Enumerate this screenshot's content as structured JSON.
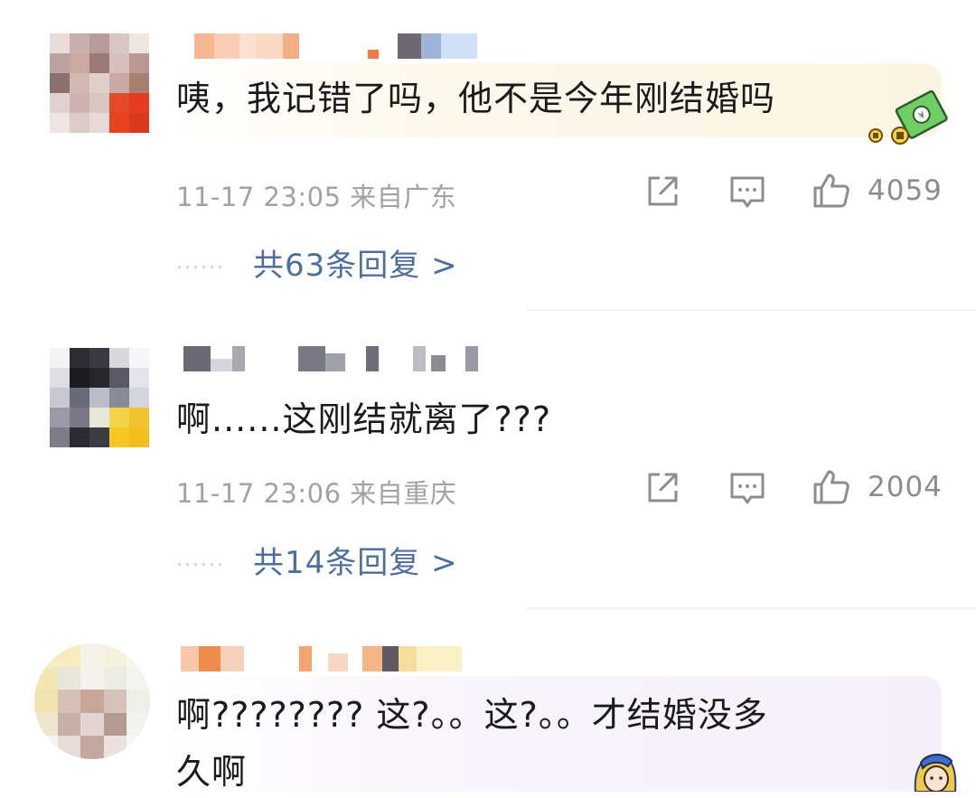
{
  "comments": [
    {
      "text": "咦，我记错了吗，他不是今年刚结婚吗",
      "meta": "11-17 23:05 来自广东",
      "likes": "4059",
      "replies": "共63条回复 >",
      "sticker": "money-sticker"
    },
    {
      "text": "啊......这刚结就离了???",
      "meta": "11-17 23:06 来自重庆",
      "likes": "2004",
      "replies": "共14条回复 >"
    },
    {
      "text_line1": "啊????????  这?。。这?。。才结婚没多",
      "text_line2": "久啊",
      "sticker": "girl-with-pearl-earring-sticker"
    }
  ],
  "reply_dots": "......",
  "icons": [
    "share-icon",
    "comment-icon",
    "like-icon"
  ],
  "colors": {
    "reply_link": "#4e6f9e",
    "meta_text": "#a2a2a2",
    "icon": "#8d8d8d",
    "bubble_1": "#fdf7e9",
    "bubble_3": "#f7f2fb"
  }
}
